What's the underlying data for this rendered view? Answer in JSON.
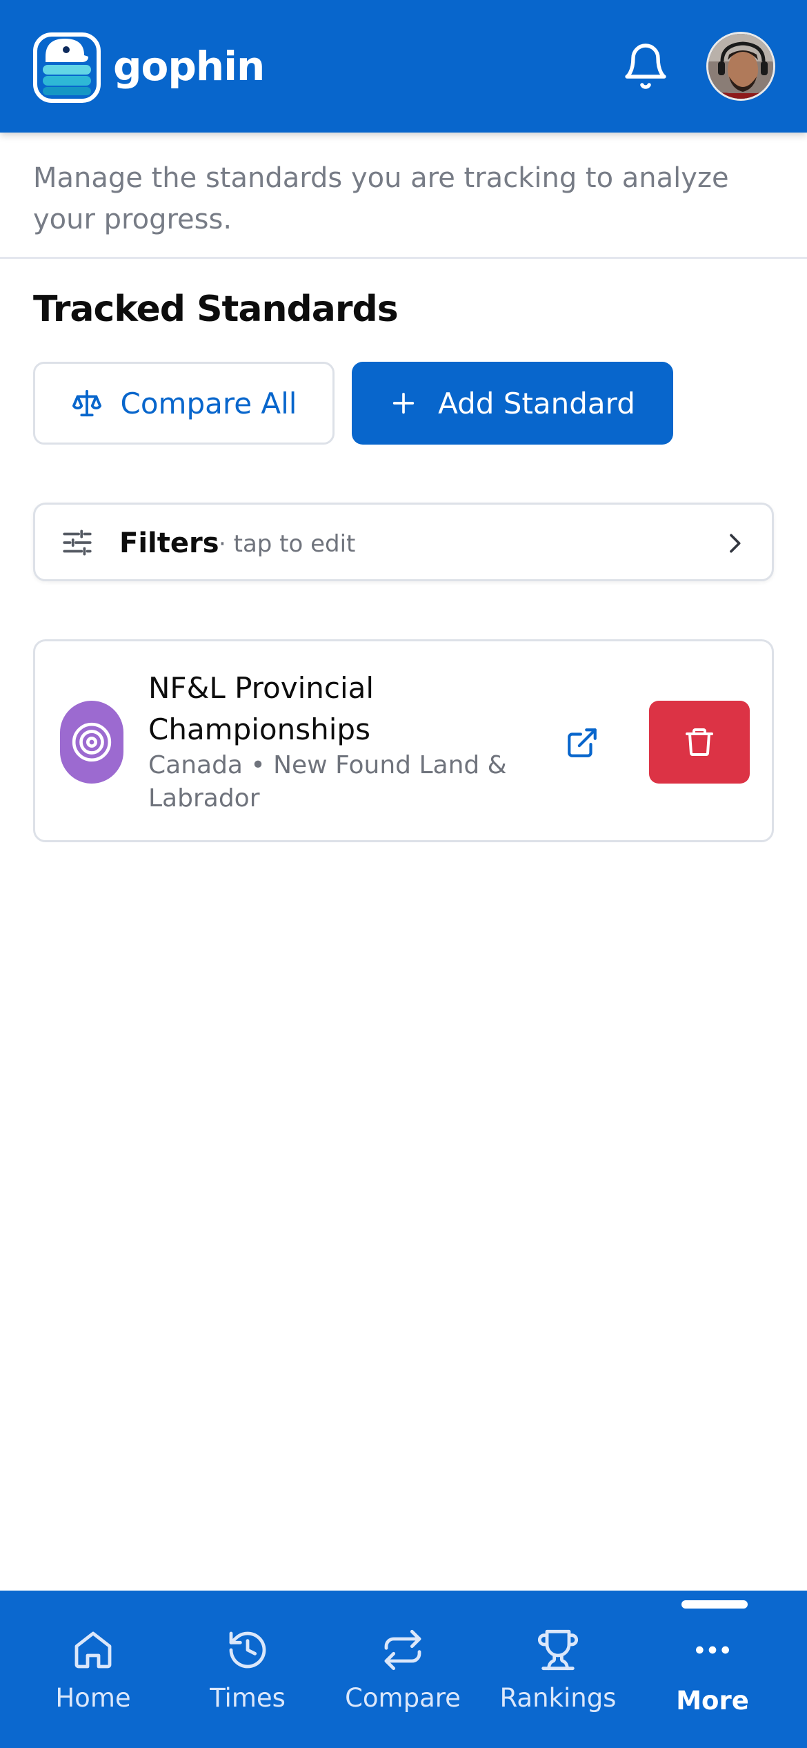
{
  "header": {
    "brand": "gophin",
    "icons": [
      "gophin-logo-icon",
      "bell-icon",
      "avatar"
    ]
  },
  "intro": {
    "text": "Manage the standards you are tracking to analyze your progress."
  },
  "section": {
    "title": "Tracked Standards"
  },
  "actions": {
    "compare_label": "Compare All",
    "add_label": "Add Standard"
  },
  "filters": {
    "label": "Filters",
    "hint": "· tap to edit"
  },
  "standards": [
    {
      "name": "NF&L Provincial Championships",
      "location": "Canada • New Found Land & Labrador",
      "icon": "target-icon"
    }
  ],
  "nav": {
    "items": [
      {
        "label": "Home",
        "icon": "home-icon"
      },
      {
        "label": "Times",
        "icon": "history-icon"
      },
      {
        "label": "Compare",
        "icon": "repeat-icon"
      },
      {
        "label": "Rankings",
        "icon": "trophy-icon"
      },
      {
        "label": "More",
        "icon": "more-icon",
        "active": true
      }
    ]
  },
  "colors": {
    "primary": "#0866cc",
    "danger": "#dc3345",
    "target": "#9c6ad0"
  }
}
